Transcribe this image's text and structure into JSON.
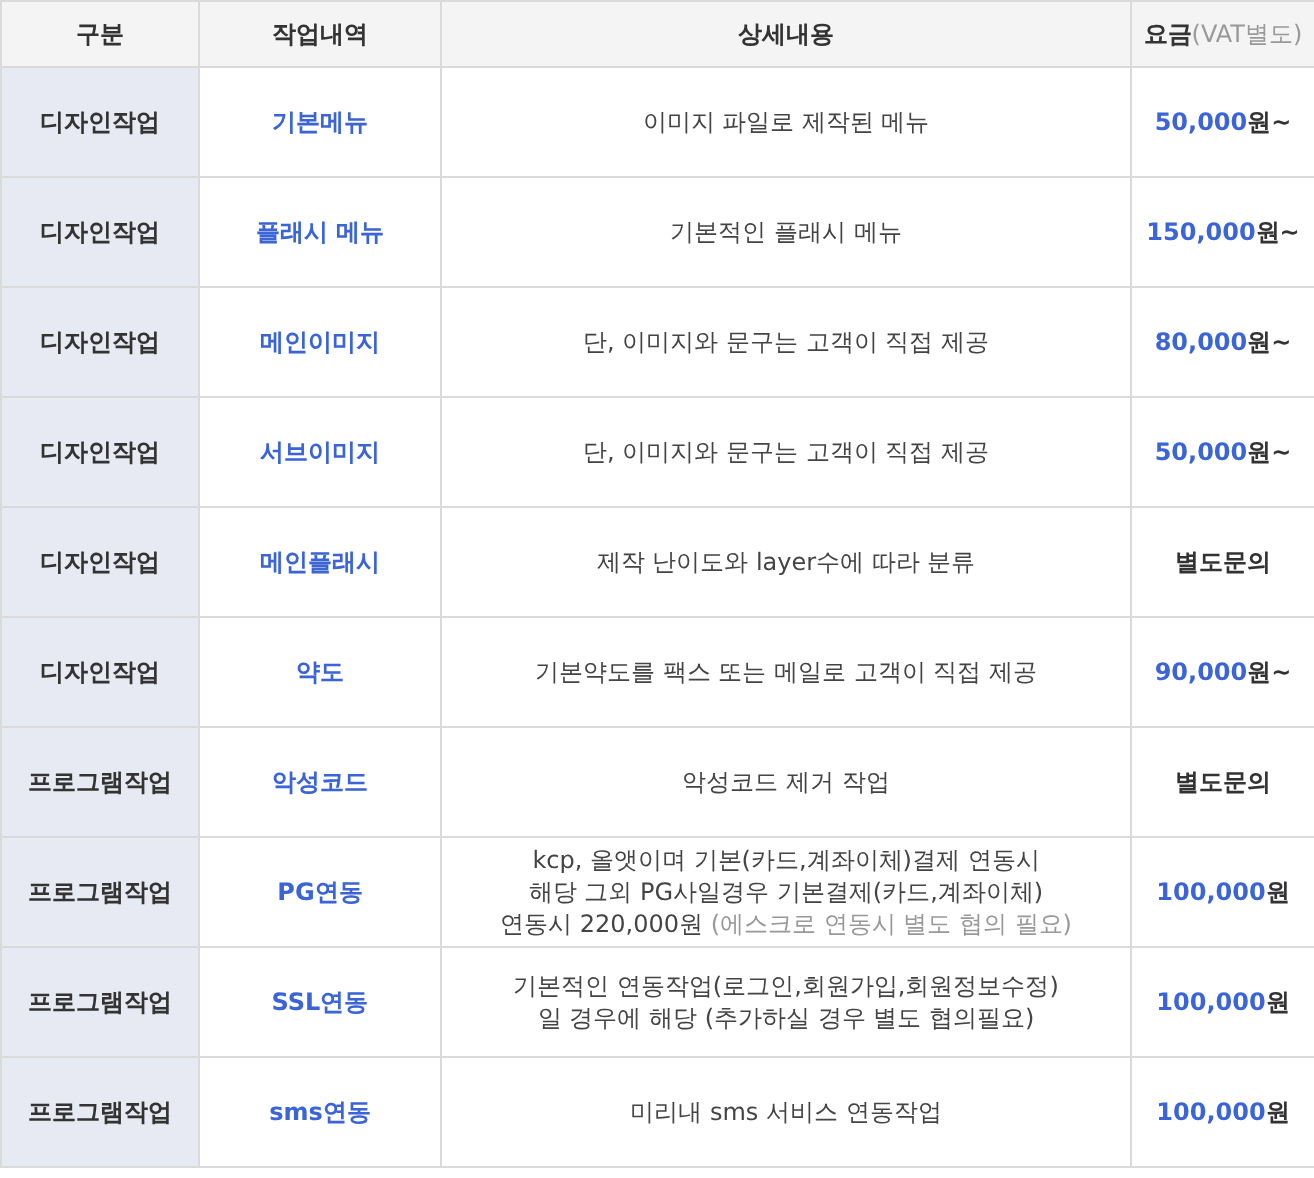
{
  "table": {
    "columns": [
      {
        "label": "구분"
      },
      {
        "label": "작업내역"
      },
      {
        "label": "상세내용"
      },
      {
        "label": "요금",
        "note": "(VAT별도)"
      }
    ],
    "rows": [
      {
        "category": "디자인작업",
        "task": "기본메뉴",
        "detail": [
          {
            "text": "이미지 파일로 제작된 메뉴"
          }
        ],
        "price": {
          "amount": "50,000",
          "suffix": "원~"
        }
      },
      {
        "category": "디자인작업",
        "task": "플래시 메뉴",
        "detail": [
          {
            "text": "기본적인 플래시 메뉴"
          }
        ],
        "price": {
          "amount": "150,000",
          "suffix": "원~"
        }
      },
      {
        "category": "디자인작업",
        "task": "메인이미지",
        "detail": [
          {
            "text": "단, 이미지와 문구는 고객이 직접 제공"
          }
        ],
        "price": {
          "amount": "80,000",
          "suffix": "원~"
        }
      },
      {
        "category": "디자인작업",
        "task": "서브이미지",
        "detail": [
          {
            "text": "단, 이미지와 문구는 고객이 직접 제공"
          }
        ],
        "price": {
          "amount": "50,000",
          "suffix": "원~"
        }
      },
      {
        "category": "디자인작업",
        "task": "메인플래시",
        "detail": [
          {
            "text": "제작 난이도와 layer수에 따라 분류"
          }
        ],
        "price": {
          "suffix": "별도문의"
        }
      },
      {
        "category": "디자인작업",
        "task": "약도",
        "detail": [
          {
            "text": "기본약도를 팩스 또는 메일로 고객이 직접 제공"
          }
        ],
        "price": {
          "amount": "90,000",
          "suffix": "원~"
        }
      },
      {
        "category": "프로그램작업",
        "task": "악성코드",
        "detail": [
          {
            "text": "악성코드 제거 작업"
          }
        ],
        "price": {
          "suffix": "별도문의"
        }
      },
      {
        "category": "프로그램작업",
        "task": "PG연동",
        "detail": [
          {
            "text": "kcp, 올앳이며 기본(카드,계좌이체)결제 연동시"
          },
          {
            "text": "해당 그외 PG사일경우 기본결제(카드,계좌이체)"
          },
          {
            "text": "연동시 220,000원",
            "note": "(에스크로 연동시 별도 협의 필요)"
          }
        ],
        "price": {
          "amount": "100,000",
          "suffix": "원"
        }
      },
      {
        "category": "프로그램작업",
        "task": "SSL연동",
        "detail": [
          {
            "text": "기본적인 연동작업(로그인,회원가입,회원정보수정)"
          },
          {
            "text": "일 경우에 해당 (추가하실 경우 별도 협의필요)"
          }
        ],
        "price": {
          "amount": "100,000",
          "suffix": "원"
        }
      },
      {
        "category": "프로그램작업",
        "task": "sms연동",
        "detail": [
          {
            "text": "미리내 sms 서비스 연동작업"
          }
        ],
        "price": {
          "amount": "100,000",
          "suffix": "원"
        }
      }
    ]
  }
}
